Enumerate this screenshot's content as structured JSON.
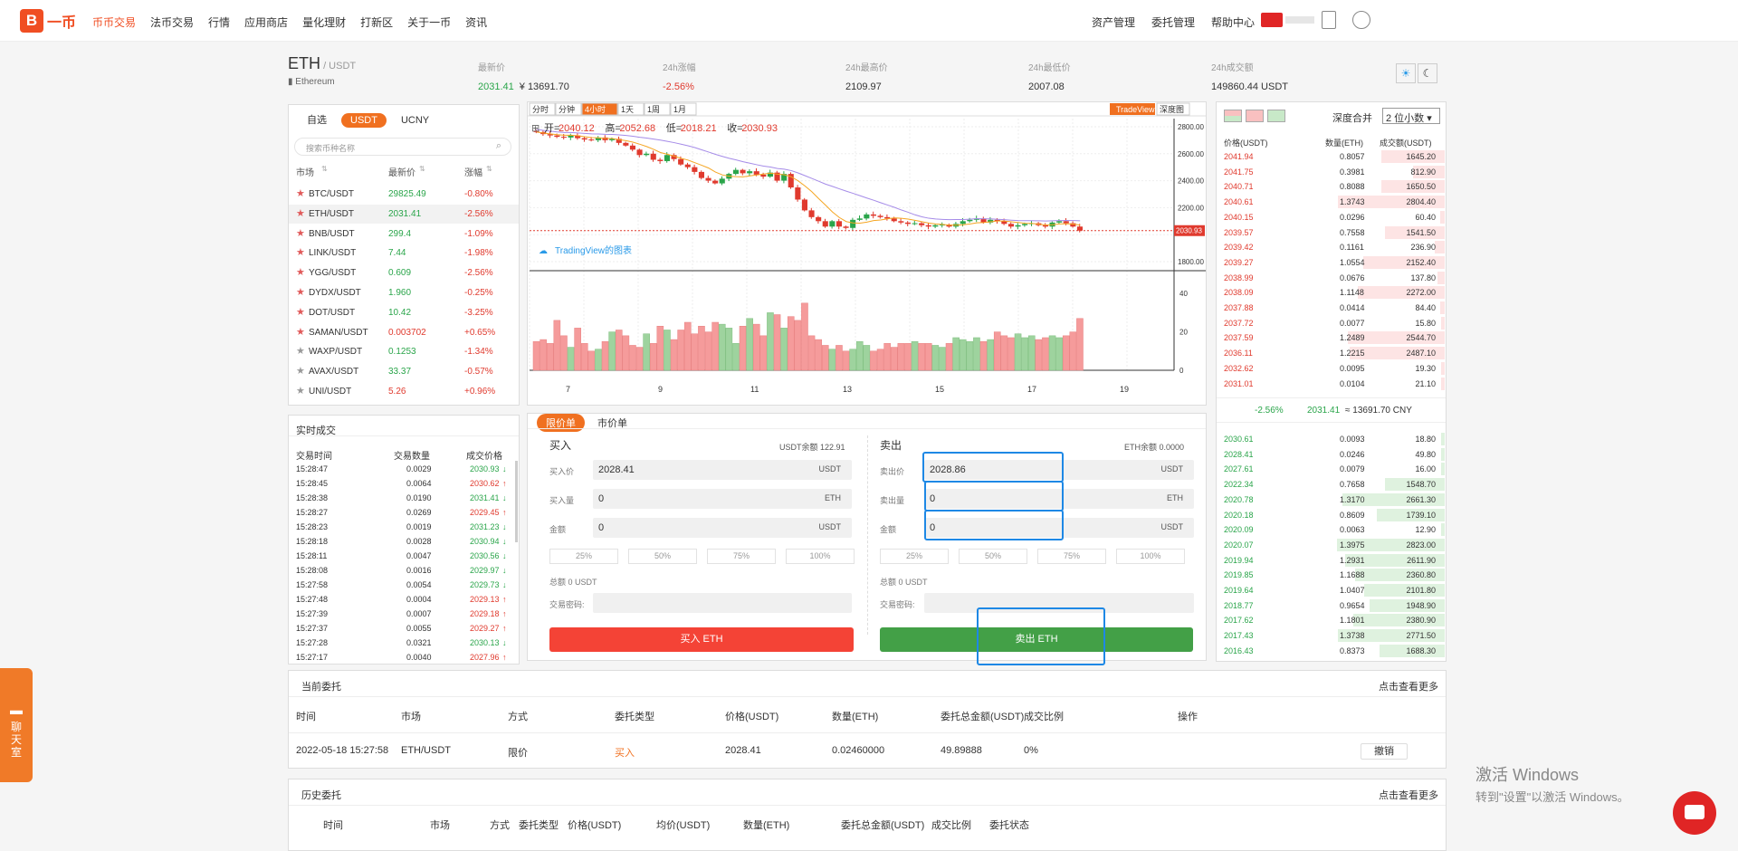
{
  "nav": {
    "logo_letter": "B",
    "logo_text": "一币",
    "items": [
      {
        "label": "币币交易",
        "active": true
      },
      {
        "label": "法币交易"
      },
      {
        "label": "行情"
      },
      {
        "label": "应用商店"
      },
      {
        "label": "量化理财"
      },
      {
        "label": "打新区"
      },
      {
        "label": "关于一币"
      },
      {
        "label": "资讯"
      }
    ],
    "right": [
      "资产管理",
      "委托管理",
      "帮助中心"
    ]
  },
  "ticker": {
    "symbol": "ETH",
    "quote": "/ USDT",
    "full_name": "Ethereum",
    "stats": [
      {
        "label": "最新价",
        "value": "2031.41",
        "extra": "¥ 13691.70"
      },
      {
        "label": "24h涨幅",
        "value": "-2.56%"
      },
      {
        "label": "24h最高价",
        "value": "2109.97"
      },
      {
        "label": "24h最低价",
        "value": "2007.08"
      },
      {
        "label": "24h成交额",
        "value": "149860.44 USDT"
      }
    ]
  },
  "market": {
    "tabs": [
      "自选",
      "USDT",
      "UCNY"
    ],
    "active_tab": "USDT",
    "search_placeholder": "搜索币种名称",
    "headers": [
      "市场",
      "最新价",
      "涨幅"
    ],
    "rows": [
      {
        "pair": "BTC/USDT",
        "price": "29825.49",
        "change": "-0.80%",
        "pc": "green",
        "cc": "red",
        "fav": true
      },
      {
        "pair": "ETH/USDT",
        "price": "2031.41",
        "change": "-2.56%",
        "pc": "green",
        "cc": "red",
        "fav": true
      },
      {
        "pair": "BNB/USDT",
        "price": "299.4",
        "change": "-1.09%",
        "pc": "green",
        "cc": "red",
        "fav": true
      },
      {
        "pair": "LINK/USDT",
        "price": "7.44",
        "change": "-1.98%",
        "pc": "green",
        "cc": "red",
        "fav": true
      },
      {
        "pair": "YGG/USDT",
        "price": "0.609",
        "change": "-2.56%",
        "pc": "green",
        "cc": "red",
        "fav": true
      },
      {
        "pair": "DYDX/USDT",
        "price": "1.960",
        "change": "-0.25%",
        "pc": "green",
        "cc": "red",
        "fav": true
      },
      {
        "pair": "DOT/USDT",
        "price": "10.42",
        "change": "-3.25%",
        "pc": "green",
        "cc": "red",
        "fav": true
      },
      {
        "pair": "SAMAN/USDT",
        "price": "0.003702",
        "change": "+0.65%",
        "pc": "red",
        "cc": "red",
        "fav": true
      },
      {
        "pair": "WAXP/USDT",
        "price": "0.1253",
        "change": "-1.34%",
        "pc": "green",
        "cc": "red",
        "fav": false
      },
      {
        "pair": "AVAX/USDT",
        "price": "33.37",
        "change": "-0.57%",
        "pc": "green",
        "cc": "red",
        "fav": false
      },
      {
        "pair": "UNI/USDT",
        "price": "5.26",
        "change": "+0.96%",
        "pc": "red",
        "cc": "red",
        "fav": false
      }
    ]
  },
  "chart": {
    "intervals": [
      "分时",
      "分钟",
      "4小时",
      "1天",
      "1周",
      "1月"
    ],
    "active_interval": "4小时",
    "tradeview": "TradeView",
    "depth": "深度图",
    "ohlc_labels": [
      "开=",
      "高=",
      "低=",
      "收="
    ],
    "ohlc_values": [
      "2040.12",
      "2052.68",
      "2018.21",
      "2030.93"
    ],
    "watermark": "TradingView的图表",
    "last_price_tag": "2030.93",
    "price_ticks": [
      "2800.00",
      "2600.00",
      "2400.00",
      "2200.00",
      "1800.00"
    ],
    "vol_ticks": [
      "40",
      "20",
      "0"
    ],
    "time_ticks": [
      "7",
      "9",
      "11",
      "13",
      "15",
      "17",
      "19"
    ]
  },
  "chart_data": {
    "type": "candlestick",
    "closes": [
      2760,
      2745,
      2735,
      2725,
      2720,
      2735,
      2715,
      2705,
      2700,
      2720,
      2700,
      2710,
      2680,
      2660,
      2630,
      2590,
      2600,
      2555,
      2545,
      2590,
      2560,
      2520,
      2500,
      2465,
      2420,
      2400,
      2380,
      2415,
      2450,
      2480,
      2455,
      2470,
      2445,
      2430,
      2460,
      2400,
      2450,
      2350,
      2260,
      2180,
      2130,
      2100,
      2060,
      2100,
      2060,
      2050,
      2110,
      2120,
      2150,
      2140,
      2130,
      2120,
      2100,
      2090,
      2080,
      2085,
      2070,
      2060,
      2070,
      2075,
      2060,
      2080,
      2100,
      2110,
      2120,
      2090,
      2110,
      2100,
      2080,
      2060,
      2070,
      2080,
      2085,
      2070,
      2060,
      2090,
      2100,
      2085,
      2060,
      2030
    ],
    "volume": [
      15,
      16,
      14,
      26,
      18,
      12,
      22,
      14,
      10,
      11,
      15,
      20,
      21,
      18,
      13,
      12,
      19,
      14,
      23,
      21,
      16,
      21,
      25,
      19,
      23,
      20,
      25,
      24,
      22,
      14,
      23,
      27,
      24,
      18,
      30,
      29,
      22,
      28,
      26,
      35,
      18,
      16,
      13,
      11,
      13,
      10,
      11,
      15,
      13,
      10,
      11,
      14,
      12,
      14,
      14,
      15,
      14,
      14,
      13,
      12,
      14,
      17,
      16,
      15,
      17,
      15,
      16,
      20,
      18,
      17,
      19,
      17,
      18,
      16,
      17,
      18,
      17,
      18,
      20,
      27
    ],
    "price_range": [
      1760,
      2860
    ],
    "volume_max": 50,
    "ma_fast_color": "#f5a623",
    "ma_slow_color": "#a58be8"
  },
  "trades": {
    "title": "实时成交",
    "headers": [
      "交易时间",
      "交易数量",
      "成交价格"
    ],
    "rows": [
      {
        "t": "15:28:47",
        "q": "0.0029",
        "p": "2030.93",
        "c": "green"
      },
      {
        "t": "15:28:45",
        "q": "0.0064",
        "p": "2030.62",
        "c": "red"
      },
      {
        "t": "15:28:38",
        "q": "0.0190",
        "p": "2031.41",
        "c": "green"
      },
      {
        "t": "15:28:27",
        "q": "0.0269",
        "p": "2029.45",
        "c": "red"
      },
      {
        "t": "15:28:23",
        "q": "0.0019",
        "p": "2031.23",
        "c": "green"
      },
      {
        "t": "15:28:18",
        "q": "0.0028",
        "p": "2030.94",
        "c": "green"
      },
      {
        "t": "15:28:11",
        "q": "0.0047",
        "p": "2030.56",
        "c": "green"
      },
      {
        "t": "15:28:08",
        "q": "0.0016",
        "p": "2029.97",
        "c": "green"
      },
      {
        "t": "15:27:58",
        "q": "0.0054",
        "p": "2029.73",
        "c": "green"
      },
      {
        "t": "15:27:48",
        "q": "0.0004",
        "p": "2029.13",
        "c": "red"
      },
      {
        "t": "15:27:39",
        "q": "0.0007",
        "p": "2029.18",
        "c": "red"
      },
      {
        "t": "15:27:37",
        "q": "0.0055",
        "p": "2029.27",
        "c": "red"
      },
      {
        "t": "15:27:28",
        "q": "0.0321",
        "p": "2030.13",
        "c": "green"
      },
      {
        "t": "15:27:17",
        "q": "0.0040",
        "p": "2027.96",
        "c": "red"
      }
    ]
  },
  "order": {
    "tabs": [
      "限价单",
      "市价单"
    ],
    "active_tab": "限价单",
    "buy": {
      "title": "买入",
      "balance": "USDT余额 122.91",
      "price_label": "买入价",
      "price": "2028.41",
      "price_unit": "USDT",
      "qty_label": "买入量",
      "qty": "0",
      "qty_unit": "ETH",
      "amt_label": "金额",
      "amt": "0",
      "amt_unit": "USDT",
      "total": "总额 0 USDT",
      "pwd_label": "交易密码:",
      "button": "买入 ETH"
    },
    "sell": {
      "title": "卖出",
      "balance": "ETH余额 0.0000",
      "price_label": "卖出价",
      "price": "2028.86",
      "price_unit": "USDT",
      "qty_label": "卖出量",
      "qty": "0",
      "qty_unit": "ETH",
      "amt_label": "金额",
      "amt": "0",
      "amt_unit": "USDT",
      "total": "总额 0 USDT",
      "pwd_label": "交易密码:",
      "button": "卖出 ETH"
    },
    "pcts": [
      "25%",
      "50%",
      "75%",
      "100%"
    ]
  },
  "orderbook": {
    "merge_label": "深度合并",
    "merge_value": "2 位小数",
    "headers": [
      "价格(USDT)",
      "数量(ETH)",
      "成交额(USDT)"
    ],
    "asks": [
      [
        "2041.94",
        "0.8057",
        "1645.20",
        0.45
      ],
      [
        "2041.75",
        "0.3981",
        "812.90",
        0.22
      ],
      [
        "2040.71",
        "0.8088",
        "1650.50",
        0.45
      ],
      [
        "2040.61",
        "1.3743",
        "2804.40",
        0.76
      ],
      [
        "2040.15",
        "0.0296",
        "60.40",
        0.02
      ],
      [
        "2039.57",
        "0.7558",
        "1541.50",
        0.42
      ],
      [
        "2039.42",
        "0.1161",
        "236.90",
        0.06
      ],
      [
        "2039.27",
        "1.0554",
        "2152.40",
        0.58
      ],
      [
        "2038.99",
        "0.0676",
        "137.80",
        0.04
      ],
      [
        "2038.09",
        "1.1148",
        "2272.00",
        0.62
      ],
      [
        "2037.88",
        "0.0414",
        "84.40",
        0.02
      ],
      [
        "2037.72",
        "0.0077",
        "15.80",
        0.01
      ],
      [
        "2037.59",
        "1.2489",
        "2544.70",
        0.69
      ],
      [
        "2036.11",
        "1.2215",
        "2487.10",
        0.68
      ],
      [
        "2032.62",
        "0.0095",
        "19.30",
        0.01
      ],
      [
        "2031.01",
        "0.0104",
        "21.10",
        0.01
      ]
    ],
    "mid": {
      "change": "-2.56%",
      "price": "2031.41",
      "cny": "≈ 13691.70 CNY"
    },
    "bids": [
      [
        "2030.61",
        "0.0093",
        "18.80",
        0.01
      ],
      [
        "2028.41",
        "0.0246",
        "49.80",
        0.01
      ],
      [
        "2027.61",
        "0.0079",
        "16.00",
        0.01
      ],
      [
        "2022.34",
        "0.7658",
        "1548.70",
        0.42
      ],
      [
        "2020.78",
        "1.3170",
        "2661.30",
        0.73
      ],
      [
        "2020.18",
        "0.8609",
        "1739.10",
        0.48
      ],
      [
        "2020.09",
        "0.0063",
        "12.90",
        0.01
      ],
      [
        "2020.07",
        "1.3975",
        "2823.00",
        0.77
      ],
      [
        "2019.94",
        "1.2931",
        "2611.90",
        0.71
      ],
      [
        "2019.85",
        "1.1688",
        "2360.80",
        0.64
      ],
      [
        "2019.64",
        "1.0407",
        "2101.80",
        0.57
      ],
      [
        "2018.77",
        "0.9654",
        "1948.90",
        0.53
      ],
      [
        "2017.62",
        "1.1801",
        "2380.90",
        0.65
      ],
      [
        "2017.43",
        "1.3738",
        "2771.50",
        0.76
      ],
      [
        "2016.43",
        "0.8373",
        "1688.30",
        0.46
      ]
    ]
  },
  "current_orders": {
    "title": "当前委托",
    "more": "点击查看更多",
    "headers": [
      "时间",
      "市场",
      "方式",
      "委托类型",
      "价格(USDT)",
      "数量(ETH)",
      "委托总金额(USDT)",
      "成交比例",
      "操作"
    ],
    "row": [
      "2022-05-18 15:27:58",
      "ETH/USDT",
      "限价",
      "买入",
      "2028.41",
      "0.02460000",
      "49.89888",
      "0%"
    ],
    "cancel": "撤销"
  },
  "history": {
    "title": "历史委托",
    "more": "点击查看更多",
    "headers": [
      "时间",
      "市场",
      "方式",
      "委托类型",
      "价格(USDT)",
      "均价(USDT)",
      "数量(ETH)",
      "委托总金额(USDT)",
      "成交比例",
      "委托状态"
    ]
  },
  "chat": {
    "label": "聊天室"
  },
  "watermark": {
    "line1": "激活 Windows",
    "line2": "转到\"设置\"以激活 Windows。"
  }
}
